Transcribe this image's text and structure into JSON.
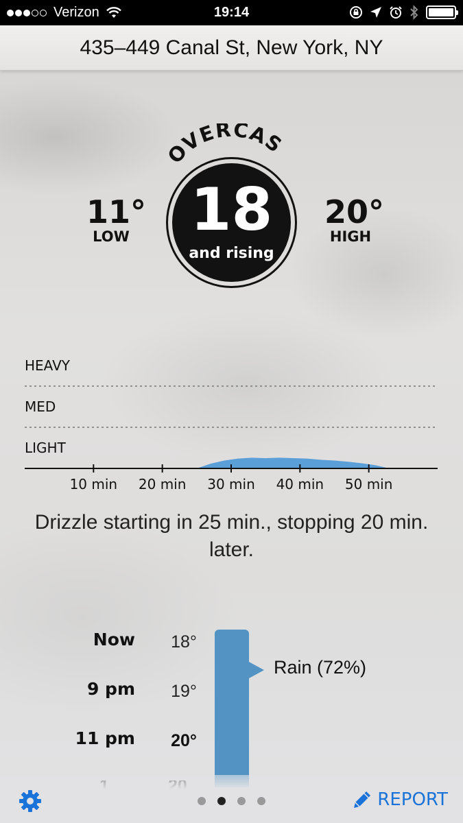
{
  "status_bar": {
    "carrier": "Verizon",
    "time": "19:14",
    "signal_bars_filled": 3,
    "signal_bars_total": 5,
    "battery_level": 1.0
  },
  "header": {
    "location": "435–449 Canal St, New York, NY"
  },
  "current": {
    "condition": "OVERCAST",
    "temp": "18",
    "trend": "and rising",
    "low_value": "11°",
    "low_label": "LOW",
    "high_value": "20°",
    "high_label": "HIGH"
  },
  "precip_chart": {
    "levels": [
      "HEAVY",
      "MED",
      "LIGHT"
    ],
    "ticks": [
      "10 min",
      "20 min",
      "30 min",
      "40 min",
      "50 min"
    ],
    "color": "#5b9fd8"
  },
  "chart_data": {
    "type": "area",
    "x": [
      25,
      27,
      29,
      31,
      33,
      35,
      37,
      39,
      41,
      43,
      45,
      47,
      49,
      51,
      53
    ],
    "values": [
      0.0,
      0.12,
      0.2,
      0.25,
      0.27,
      0.26,
      0.27,
      0.26,
      0.25,
      0.22,
      0.2,
      0.17,
      0.13,
      0.08,
      0.0
    ],
    "xlabel": "",
    "ylabel": "",
    "xlim": [
      0,
      60
    ],
    "ylim": [
      0,
      3
    ],
    "x_tick_labels": [
      "10 min",
      "20 min",
      "30 min",
      "40 min",
      "50 min"
    ],
    "y_tick_labels": [
      "LIGHT",
      "MED",
      "HEAVY"
    ],
    "grid": true
  },
  "summary": "Drizzle starting in 25 min., stopping 20 min. later.",
  "hourly": {
    "rows": [
      {
        "time": "Now",
        "temp": "18°",
        "bold": false
      },
      {
        "time": "9 pm",
        "temp": "19°",
        "bold": false
      },
      {
        "time": "11 pm",
        "temp": "20°",
        "bold": true
      }
    ],
    "rain_label": "Rain (72%)",
    "bar_color": "#5293c4"
  },
  "footer": {
    "report_label": "REPORT",
    "page_count": 4,
    "active_page": 2,
    "accent": "#1a73d9"
  }
}
